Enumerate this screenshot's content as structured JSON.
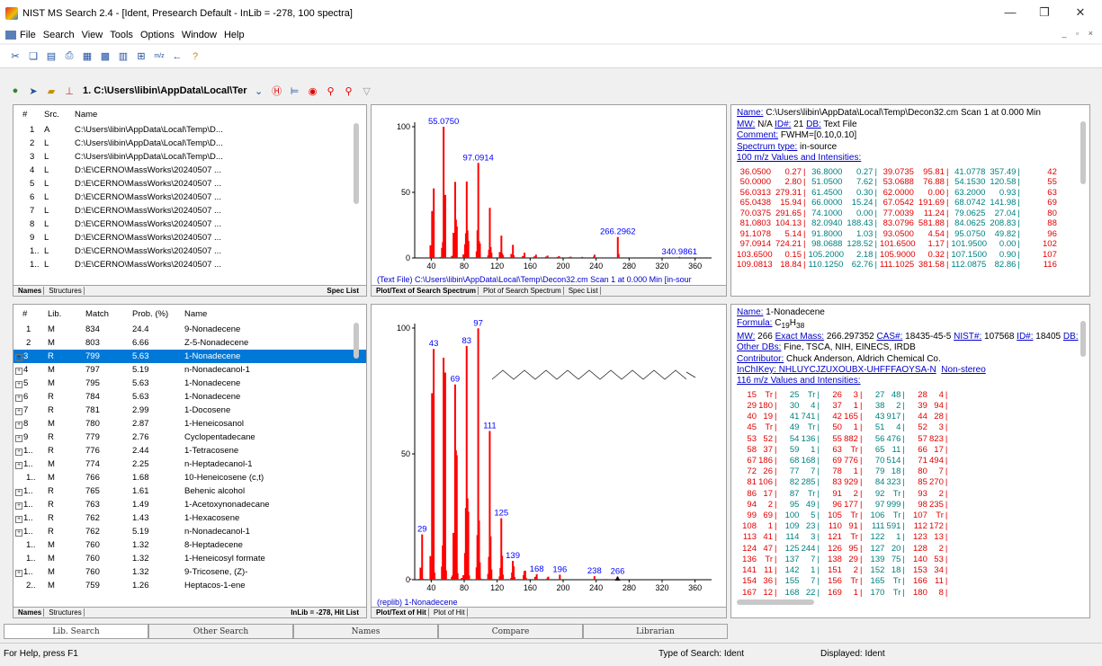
{
  "window": {
    "title": "NIST MS Search 2.4 - [Ident, Presearch Default - InLib = -278, 100 spectra]"
  },
  "menu": [
    "File",
    "Search",
    "View",
    "Tools",
    "Options",
    "Window",
    "Help"
  ],
  "toolbar2": {
    "file_combo": "1. C:\\Users\\libin\\AppData\\Local\\Ter"
  },
  "spec_list": {
    "headers": [
      "#",
      "Src.",
      "Name"
    ],
    "rows": [
      [
        "1",
        "A",
        "C:\\Users\\libin\\AppData\\Local\\Temp\\D..."
      ],
      [
        "2",
        "L",
        "C:\\Users\\libin\\AppData\\Local\\Temp\\D..."
      ],
      [
        "3",
        "L",
        "C:\\Users\\libin\\AppData\\Local\\Temp\\D..."
      ],
      [
        "4",
        "L",
        "D:\\E\\CERNO\\MassWorks\\20240507 ..."
      ],
      [
        "5",
        "L",
        "D:\\E\\CERNO\\MassWorks\\20240507 ..."
      ],
      [
        "6",
        "L",
        "D:\\E\\CERNO\\MassWorks\\20240507 ..."
      ],
      [
        "7",
        "L",
        "D:\\E\\CERNO\\MassWorks\\20240507 ..."
      ],
      [
        "8",
        "L",
        "D:\\E\\CERNO\\MassWorks\\20240507 ..."
      ],
      [
        "9",
        "L",
        "D:\\E\\CERNO\\MassWorks\\20240507 ..."
      ],
      [
        "1..",
        "L",
        "D:\\E\\CERNO\\MassWorks\\20240507 ..."
      ],
      [
        "1..",
        "L",
        "D:\\E\\CERNO\\MassWorks\\20240507 ..."
      ]
    ],
    "tabs": [
      "Names",
      "Structures"
    ],
    "right_label": "Spec List"
  },
  "hit_list": {
    "headers": [
      "#",
      "Lib.",
      "Match",
      "Prob. (%)",
      "Name"
    ],
    "rows": [
      [
        "1",
        "M",
        "834",
        "24.4",
        "9-Nonadecene",
        false
      ],
      [
        "2",
        "M",
        "803",
        "6.66",
        "Z-5-Nonadecene",
        false
      ],
      [
        "3",
        "R",
        "799",
        "5.63",
        "1-Nonadecene",
        true
      ],
      [
        "4",
        "M",
        "797",
        "5.19",
        "n-Nonadecanol-1",
        true
      ],
      [
        "5",
        "M",
        "795",
        "5.63",
        "1-Nonadecene",
        true
      ],
      [
        "6",
        "R",
        "784",
        "5.63",
        "1-Nonadecene",
        true
      ],
      [
        "7",
        "R",
        "781",
        "2.99",
        "1-Docosene",
        true
      ],
      [
        "8",
        "M",
        "780",
        "2.87",
        "1-Heneicosanol",
        true
      ],
      [
        "9",
        "R",
        "779",
        "2.76",
        "Cyclopentadecane",
        true
      ],
      [
        "1..",
        "R",
        "776",
        "2.44",
        "1-Tetracosene",
        true
      ],
      [
        "1..",
        "M",
        "774",
        "2.25",
        "n-Heptadecanol-1",
        true
      ],
      [
        "1..",
        "M",
        "766",
        "1.68",
        "10-Heneicosene (c,t)",
        false
      ],
      [
        "1..",
        "R",
        "765",
        "1.61",
        "Behenic alcohol",
        true
      ],
      [
        "1..",
        "R",
        "763",
        "1.49",
        "1-Acetoxynonadecane",
        true
      ],
      [
        "1..",
        "R",
        "762",
        "1.43",
        "1-Hexacosene",
        true
      ],
      [
        "1..",
        "R",
        "762",
        "5.19",
        "n-Nonadecanol-1",
        true
      ],
      [
        "1..",
        "M",
        "760",
        "1.32",
        "8-Heptadecene",
        false
      ],
      [
        "1..",
        "M",
        "760",
        "1.32",
        "1-Heneicosyl formate",
        false
      ],
      [
        "1..",
        "M",
        "760",
        "1.32",
        "9-Tricosene, (Z)-",
        true
      ],
      [
        "2..",
        "M",
        "759",
        "1.26",
        "Heptacos-1-ene",
        false
      ]
    ],
    "selected_index": 2,
    "tabs": [
      "Names",
      "Structures"
    ],
    "right_label": "InLib = -278, Hit List"
  },
  "search_plot": {
    "caption": "(Text File) C:\\Users\\libin\\AppData\\Local\\Temp\\Decon32.cm Scan 1 at 0.000 Min  [in-sour",
    "tabs": [
      "Plot/Text of Search Spectrum",
      "Plot of Search Spectrum",
      "Spec List"
    ],
    "y_ticks": [
      "100",
      "50",
      "0"
    ],
    "x_ticks": [
      "40",
      "80",
      "120",
      "160",
      "200",
      "240",
      "280",
      "320",
      "360"
    ],
    "x_range": [
      20,
      380
    ],
    "peak_labels": [
      {
        "mz": 55.075,
        "text": "55.0750"
      },
      {
        "mz": 97.0914,
        "text": "97.0914"
      },
      {
        "mz": 266.2962,
        "text": "266.2962"
      },
      {
        "mz": 340.9861,
        "text": "340.9861"
      }
    ],
    "peaks": [
      [
        36.05,
        0.27
      ],
      [
        39.07,
        95.81
      ],
      [
        41.08,
        357.49
      ],
      [
        43.09,
        530
      ],
      [
        50,
        2.8
      ],
      [
        51.05,
        7.62
      ],
      [
        53.07,
        76.88
      ],
      [
        54.15,
        120.58
      ],
      [
        55.075,
        1000
      ],
      [
        56.03,
        279.31
      ],
      [
        57.07,
        480
      ],
      [
        65.04,
        15.94
      ],
      [
        67.05,
        191.69
      ],
      [
        68.07,
        141.98
      ],
      [
        69.08,
        580
      ],
      [
        70.04,
        291.65
      ],
      [
        71.09,
        240
      ],
      [
        79.06,
        27.04
      ],
      [
        81.08,
        104.13
      ],
      [
        82.09,
        188.43
      ],
      [
        83.08,
        581.88
      ],
      [
        84.06,
        208.83
      ],
      [
        85.1,
        130
      ],
      [
        91.11,
        5.14
      ],
      [
        95.09,
        49.82
      ],
      [
        96.1,
        210
      ],
      [
        97.0914,
        724.21
      ],
      [
        98.07,
        128.52
      ],
      [
        99.1,
        110
      ],
      [
        109.08,
        18.84
      ],
      [
        110.13,
        62.76
      ],
      [
        111.1,
        381.58
      ],
      [
        112.09,
        82.86
      ],
      [
        113.1,
        40
      ],
      [
        123.1,
        45
      ],
      [
        125.1,
        170
      ],
      [
        126.1,
        35
      ],
      [
        127.1,
        20
      ],
      [
        137.1,
        30
      ],
      [
        139.1,
        100
      ],
      [
        140.1,
        20
      ],
      [
        151.1,
        15
      ],
      [
        153.1,
        40
      ],
      [
        165.1,
        12
      ],
      [
        167.1,
        25
      ],
      [
        179.1,
        10
      ],
      [
        181.1,
        18
      ],
      [
        193.1,
        8
      ],
      [
        195.1,
        14
      ],
      [
        207.1,
        6
      ],
      [
        209.1,
        10
      ],
      [
        223.1,
        8
      ],
      [
        237.1,
        10
      ],
      [
        238.1,
        25
      ],
      [
        252.1,
        5
      ],
      [
        266.2962,
        160
      ],
      [
        267.3,
        30
      ],
      [
        340.9861,
        8
      ]
    ]
  },
  "hit_plot": {
    "caption": "(replib) 1-Nonadecene",
    "tabs": [
      "Plot/Text of Hit",
      "Plot of Hit"
    ],
    "y_ticks": [
      "100",
      "50",
      "0"
    ],
    "x_ticks": [
      "40",
      "80",
      "120",
      "160",
      "200",
      "240",
      "280",
      "320",
      "360"
    ],
    "x_range": [
      20,
      380
    ],
    "peak_labels": [
      {
        "mz": 29,
        "text": "29"
      },
      {
        "mz": 43,
        "text": "43"
      },
      {
        "mz": 69,
        "text": "69"
      },
      {
        "mz": 83,
        "text": "83"
      },
      {
        "mz": 97,
        "text": "97"
      },
      {
        "mz": 111,
        "text": "111"
      },
      {
        "mz": 125,
        "text": "125"
      },
      {
        "mz": 139,
        "text": "139"
      },
      {
        "mz": 168,
        "text": "168"
      },
      {
        "mz": 196,
        "text": "196"
      },
      {
        "mz": 238,
        "text": "238"
      },
      {
        "mz": 266,
        "text": "266"
      }
    ],
    "peaks": [
      [
        15,
        4
      ],
      [
        25,
        3
      ],
      [
        26,
        3
      ],
      [
        27,
        48
      ],
      [
        28,
        4
      ],
      [
        29,
        180
      ],
      [
        30,
        4
      ],
      [
        37,
        1
      ],
      [
        38,
        2
      ],
      [
        39,
        94
      ],
      [
        40,
        19
      ],
      [
        41,
        741
      ],
      [
        42,
        165
      ],
      [
        43,
        917
      ],
      [
        44,
        28
      ],
      [
        53,
        52
      ],
      [
        54,
        136
      ],
      [
        55,
        882
      ],
      [
        56,
        476
      ],
      [
        57,
        823
      ],
      [
        58,
        37
      ],
      [
        59,
        1
      ],
      [
        63,
        1
      ],
      [
        65,
        11
      ],
      [
        66,
        17
      ],
      [
        67,
        186
      ],
      [
        68,
        168
      ],
      [
        69,
        776
      ],
      [
        70,
        514
      ],
      [
        71,
        494
      ],
      [
        72,
        26
      ],
      [
        77,
        7
      ],
      [
        78,
        1
      ],
      [
        79,
        18
      ],
      [
        80,
        7
      ],
      [
        81,
        106
      ],
      [
        82,
        285
      ],
      [
        83,
        929
      ],
      [
        84,
        323
      ],
      [
        85,
        270
      ],
      [
        86,
        17
      ],
      [
        87,
        1
      ],
      [
        91,
        2
      ],
      [
        92,
        1
      ],
      [
        93,
        2
      ],
      [
        94,
        2
      ],
      [
        95,
        49
      ],
      [
        96,
        177
      ],
      [
        97,
        999
      ],
      [
        98,
        235
      ],
      [
        99,
        69
      ],
      [
        100,
        5
      ],
      [
        108,
        1
      ],
      [
        109,
        23
      ],
      [
        110,
        91
      ],
      [
        111,
        591
      ],
      [
        112,
        172
      ],
      [
        113,
        41
      ],
      [
        114,
        3
      ],
      [
        121,
        1
      ],
      [
        122,
        1
      ],
      [
        123,
        13
      ],
      [
        124,
        47
      ],
      [
        125,
        244
      ],
      [
        126,
        95
      ],
      [
        127,
        20
      ],
      [
        128,
        2
      ],
      [
        136,
        1
      ],
      [
        137,
        7
      ],
      [
        138,
        29
      ],
      [
        139,
        75
      ],
      [
        140,
        53
      ],
      [
        141,
        11
      ],
      [
        142,
        1
      ],
      [
        151,
        2
      ],
      [
        152,
        18
      ],
      [
        153,
        34
      ],
      [
        154,
        36
      ],
      [
        155,
        7
      ],
      [
        156,
        1
      ],
      [
        165,
        1
      ],
      [
        166,
        11
      ],
      [
        167,
        12
      ],
      [
        168,
        22
      ],
      [
        181,
        8
      ],
      [
        182,
        12
      ],
      [
        196,
        20
      ],
      [
        238,
        14
      ],
      [
        252,
        3
      ],
      [
        266,
        12
      ]
    ]
  },
  "search_info": {
    "name_label": "Name:",
    "name": "C:\\Users\\libin\\AppData\\Local\\Temp\\Decon32.cm Scan 1 at 0.000 Min",
    "mw_line": [
      "MW:",
      " N/A ",
      "ID#:",
      " 21 ",
      "DB:",
      " Text File"
    ],
    "comment_label": "Comment:",
    "comment": " FWHM=[0.10,0.10]",
    "type_label": "Spectrum type:",
    "type": " in-source",
    "values_header": "100 m/z Values and Intensities:",
    "peak_rows": [
      [
        "36.0500",
        "0.27",
        "36.8000",
        "0.27",
        "39.0735",
        "95.81",
        "41.0778",
        "357.49",
        "42"
      ],
      [
        "50.0000",
        "2.80",
        "51.0500",
        "7.62",
        "53.0688",
        "76.88",
        "54.1530",
        "120.58",
        "55"
      ],
      [
        "56.0313",
        "279.31",
        "61.4500",
        "0.30",
        "62.0000",
        "0.00",
        "63.2000",
        "0.93",
        "63"
      ],
      [
        "65.0438",
        "15.94",
        "66.0000",
        "15.24",
        "67.0542",
        "191.69",
        "68.0742",
        "141.98",
        "69"
      ],
      [
        "70.0375",
        "291.65",
        "74.1000",
        "0.00",
        "77.0039",
        "11.24",
        "79.0625",
        "27.04",
        "80"
      ],
      [
        "81.0803",
        "104.13",
        "82.0940",
        "188.43",
        "83.0796",
        "581.88",
        "84.0625",
        "208.83",
        "88"
      ],
      [
        "91.1078",
        "5.14",
        "91.8000",
        "1.03",
        "93.0500",
        "4.54",
        "95.0750",
        "49.82",
        "96"
      ],
      [
        "97.0914",
        "724.21",
        "98.0688",
        "128.52",
        "101.6500",
        "1.17",
        "101.9500",
        "0.00",
        "102"
      ],
      [
        "103.6500",
        "0.15",
        "105.2000",
        "2.18",
        "105.9000",
        "0.32",
        "107.1500",
        "0.90",
        "107"
      ],
      [
        "109.0813",
        "18.84",
        "110.1250",
        "62.76",
        "111.1025",
        "381.58",
        "112.0875",
        "82.86",
        "116"
      ]
    ]
  },
  "hit_info": {
    "name_label": "Name:",
    "name": " 1-Nonadecene",
    "formula_label": "Formula:",
    "formula": " C19H38",
    "mw_label": "MW:",
    "mw": " 266 ",
    "exact_label": "Exact Mass:",
    "exact": " 266.297352 ",
    "cas_label": "CAS#:",
    "cas": " 18435-45-5 ",
    "nist_label": "NIST#:",
    "nist": " 107568 ",
    "id_label": "ID#:",
    "id": " 18405 ",
    "db_label": "DB:",
    "otherdb_label": "Other DBs:",
    "otherdb": " Fine, TSCA, NIH, EINECS, IRDB",
    "contrib_label": "Contributor:",
    "contrib": " Chuck Anderson, Aldrich Chemical Co.",
    "inchi_label": "InChIKey:",
    "inchi": " NHLUYCJZUXOUBX-UHFFFAOYSA-N",
    "nonstereo": "Non-stereo",
    "values_header": "116 m/z Values and Intensities:",
    "peak_rows": [
      [
        "15",
        "Tr",
        "25",
        "Tr",
        "26",
        "3",
        "27",
        "48",
        "28",
        "4"
      ],
      [
        "29",
        "180",
        "30",
        "4",
        "37",
        "1",
        "38",
        "2",
        "39",
        "94"
      ],
      [
        "40",
        "19",
        "41",
        "741",
        "42",
        "165",
        "43",
        "917",
        "44",
        "28"
      ],
      [
        "45",
        "Tr",
        "49",
        "Tr",
        "50",
        "1",
        "51",
        "4",
        "52",
        "3"
      ],
      [
        "53",
        "52",
        "54",
        "136",
        "55",
        "882",
        "56",
        "476",
        "57",
        "823"
      ],
      [
        "58",
        "37",
        "59",
        "1",
        "63",
        "Tr",
        "65",
        "11",
        "66",
        "17"
      ],
      [
        "67",
        "186",
        "68",
        "168",
        "69",
        "776",
        "70",
        "514",
        "71",
        "494"
      ],
      [
        "72",
        "26",
        "77",
        "7",
        "78",
        "1",
        "79",
        "18",
        "80",
        "7"
      ],
      [
        "81",
        "106",
        "82",
        "285",
        "83",
        "929",
        "84",
        "323",
        "85",
        "270"
      ],
      [
        "86",
        "17",
        "87",
        "Tr",
        "91",
        "2",
        "92",
        "Tr",
        "93",
        "2"
      ],
      [
        "94",
        "2",
        "95",
        "49",
        "96",
        "177",
        "97",
        "999",
        "98",
        "235"
      ],
      [
        "99",
        "69",
        "100",
        "5",
        "105",
        "Tr",
        "106",
        "Tr",
        "107",
        "Tr"
      ],
      [
        "108",
        "1",
        "109",
        "23",
        "110",
        "91",
        "111",
        "591",
        "112",
        "172"
      ],
      [
        "113",
        "41",
        "114",
        "3",
        "121",
        "Tr",
        "122",
        "1",
        "123",
        "13"
      ],
      [
        "124",
        "47",
        "125",
        "244",
        "126",
        "95",
        "127",
        "20",
        "128",
        "2"
      ],
      [
        "136",
        "Tr",
        "137",
        "7",
        "138",
        "29",
        "139",
        "75",
        "140",
        "53"
      ],
      [
        "141",
        "11",
        "142",
        "1",
        "151",
        "2",
        "152",
        "18",
        "153",
        "34"
      ],
      [
        "154",
        "36",
        "155",
        "7",
        "156",
        "Tr",
        "165",
        "Tr",
        "166",
        "11"
      ],
      [
        "167",
        "12",
        "168",
        "22",
        "169",
        "1",
        "170",
        "Tr",
        "180",
        "8"
      ]
    ]
  },
  "bottom_tabs": [
    "Lib. Search",
    "Other Search",
    "Names",
    "Compare",
    "Librarian"
  ],
  "status": {
    "help": "For Help, press F1",
    "search_type": "Type of Search: Ident",
    "displayed": "Displayed: Ident"
  },
  "colors": {
    "peak": "#ff0000",
    "label": "#0000ff",
    "selection": "#0078d7"
  }
}
